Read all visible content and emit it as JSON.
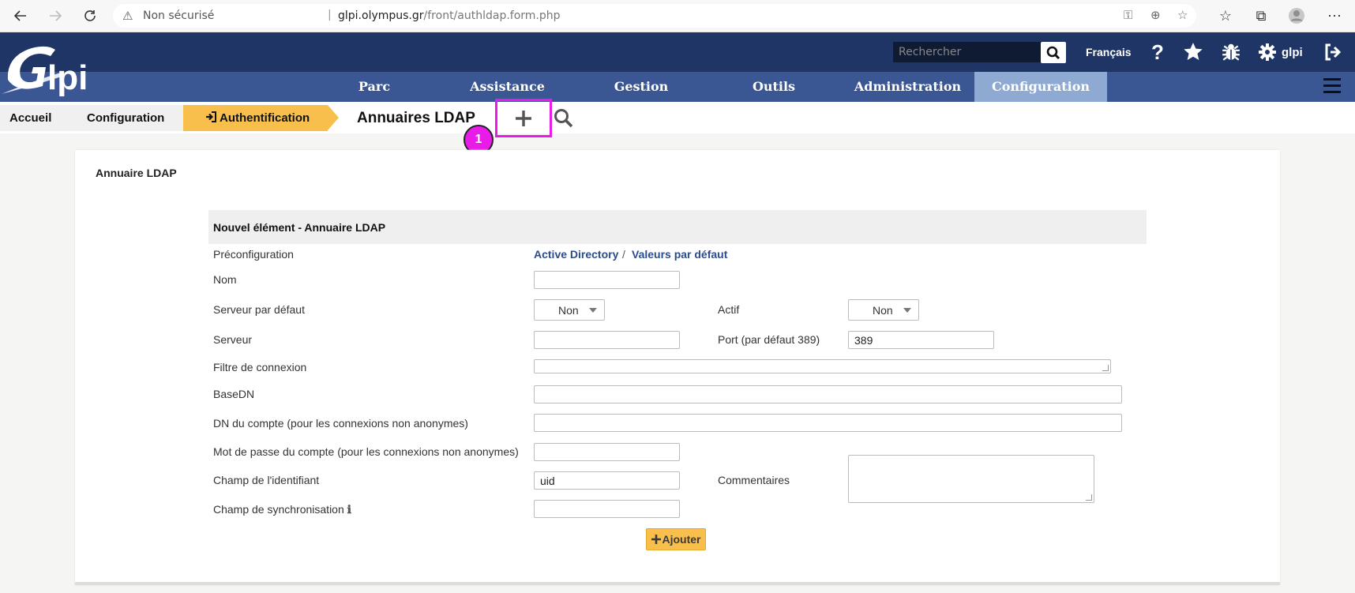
{
  "browser": {
    "security_label": "Non sécurisé",
    "url_host": "glpi.olympus.gr",
    "url_path": "/front/authldap.form.php"
  },
  "header": {
    "logo_text": "Glpi",
    "search_placeholder": "Rechercher",
    "language": "Français",
    "user": "glpi"
  },
  "nav": {
    "items": [
      "Parc",
      "Assistance",
      "Gestion",
      "Outils",
      "Administration",
      "Configuration"
    ],
    "active": "Configuration"
  },
  "breadcrumb": {
    "items": [
      "Accueil",
      "Configuration",
      "Authentification"
    ]
  },
  "page": {
    "title": "Annuaires LDAP",
    "badge": "1",
    "card_title": "Annuaire LDAP"
  },
  "form": {
    "header": "Nouvel élément - Annuaire LDAP",
    "preconfig_label": "Préconfiguration",
    "preconfig_links": [
      "Active Directory",
      "/",
      "Valeurs par défaut"
    ],
    "nom_label": "Nom",
    "serveur_defaut_label": "Serveur par défaut",
    "serveur_defaut_value": "Non",
    "actif_label": "Actif",
    "actif_value": "Non",
    "serveur_label": "Serveur",
    "port_label": "Port (par défaut 389)",
    "port_value": "389",
    "filtre_label": "Filtre de connexion",
    "basedn_label": "BaseDN",
    "dn_compte_label": "DN du compte (pour les connexions non anonymes)",
    "mdp_label": "Mot de passe du compte (pour les connexions non anonymes)",
    "identifiant_label": "Champ de l'identifiant",
    "identifiant_value": "uid",
    "commentaires_label": "Commentaires",
    "sync_label": "Champ de synchronisation",
    "submit_label": "Ajouter"
  }
}
